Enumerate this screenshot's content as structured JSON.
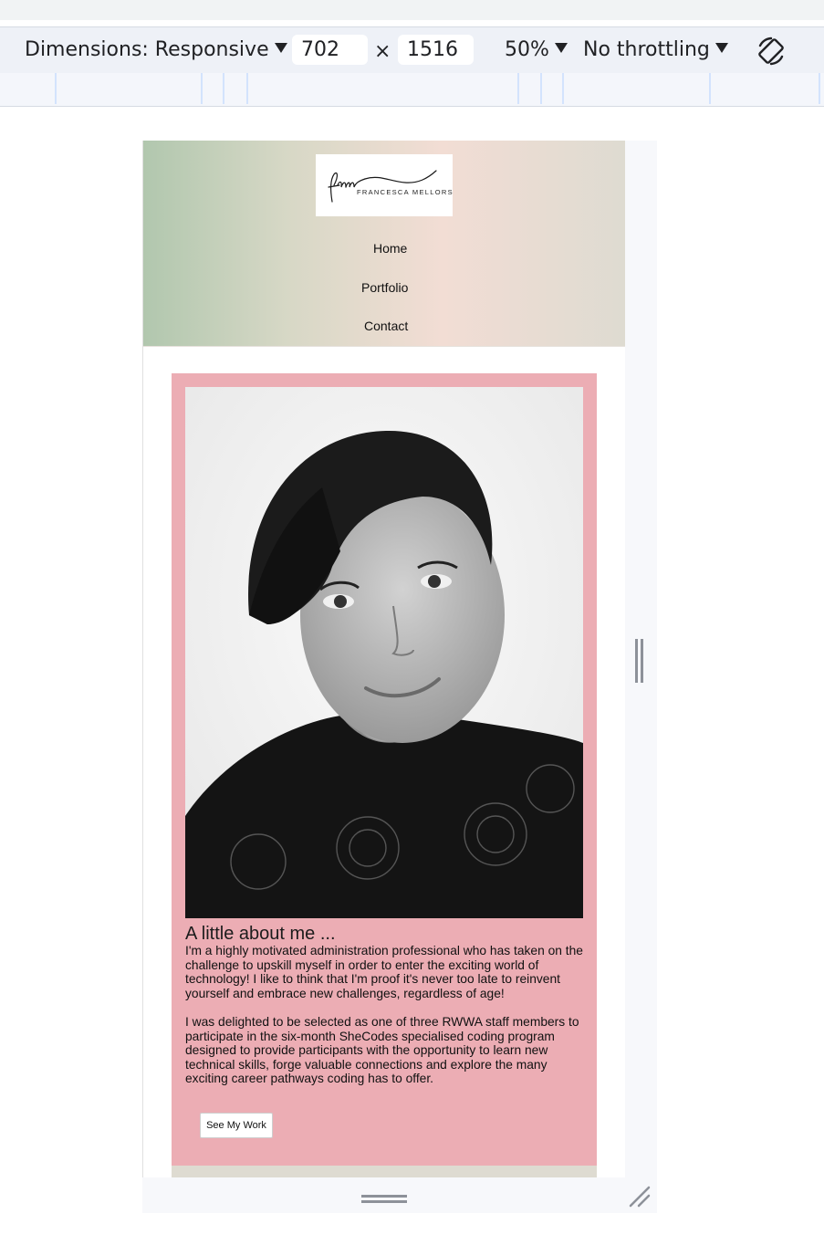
{
  "devtools": {
    "dimensions_label": "Dimensions: Responsive",
    "width_value": "702",
    "times_symbol": "×",
    "height_value": "1516",
    "zoom_label": "50%",
    "throttling_label": "No throttling"
  },
  "site": {
    "logo": {
      "monogram": "fm",
      "name": "FRANCESCA MELLORS"
    },
    "nav": [
      {
        "label": "Home"
      },
      {
        "label": "Portfolio"
      },
      {
        "label": "Contact"
      }
    ],
    "about": {
      "title": "A little about me ...",
      "paragraphs": [
        "I'm a highly motivated administration professional who has taken on the challenge to upskill myself in order to enter the exciting world of technology! I like to think that I'm proof it's never too late to reinvent yourself and embrace new challenges, regardless of age!",
        "I was delighted to be selected as one of three RWWA staff members to participate in the six-month SheCodes specialised coding program designed to provide participants with the opportunity to learn new technical skills, forge valuable connections and explore the many exciting career pathways coding has to offer."
      ],
      "button_label": "See My Work"
    }
  },
  "colors": {
    "card_pink": "#ecadb4",
    "header_green": "#b1c7ae",
    "header_peach": "#f2ddd4",
    "toolbar_bg": "#eef1f7"
  }
}
